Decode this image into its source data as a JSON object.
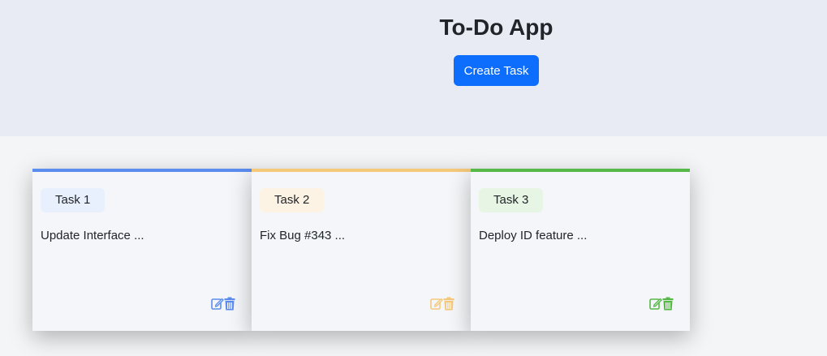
{
  "header": {
    "title": "To-Do App",
    "create_button_label": "Create Task"
  },
  "tasks": [
    {
      "badge": "Task 1",
      "description": "Update Interface ...",
      "accent_color": "#5b8def",
      "badge_bg": "#e9f0fd",
      "edit_icon": "edit-icon",
      "delete_icon": "trash-icon"
    },
    {
      "badge": "Task 2",
      "description": "Fix Bug #343 ...",
      "accent_color": "#f5c97a",
      "badge_bg": "#fdf3e4",
      "edit_icon": "edit-icon",
      "delete_icon": "trash-icon"
    },
    {
      "badge": "Task 3",
      "description": "Deploy ID feature ...",
      "accent_color": "#56b847",
      "badge_bg": "#e7f5e5",
      "edit_icon": "edit-icon",
      "delete_icon": "trash-icon"
    }
  ]
}
